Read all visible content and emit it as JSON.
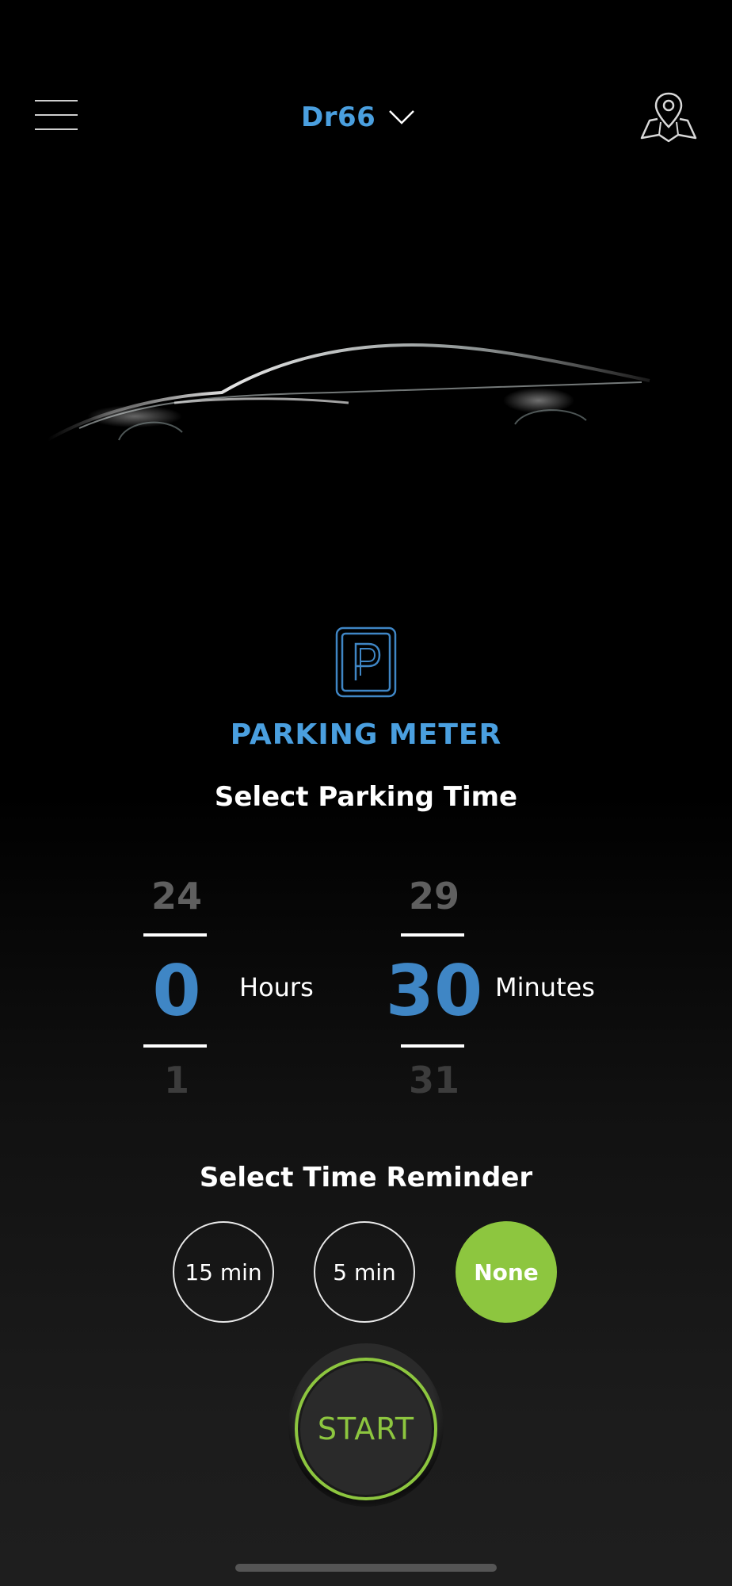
{
  "header": {
    "vehicle_name": "Dr66",
    "menu_icon": "hamburger-menu-icon",
    "vehicle_dropdown_icon": "chevron-down-icon",
    "map_icon": "map-pin-icon"
  },
  "parking": {
    "icon": "parking-sign-icon",
    "title": "PARKING METER",
    "subtitle": "Select Parking Time",
    "hours": {
      "prev": "24",
      "current": "0",
      "next": "1",
      "unit": "Hours"
    },
    "minutes": {
      "prev": "29",
      "current": "30",
      "next": "31",
      "unit": "Minutes"
    }
  },
  "reminder": {
    "title": "Select Time Reminder",
    "options": [
      {
        "label": "15 min",
        "selected": false
      },
      {
        "label": "5 min",
        "selected": false
      },
      {
        "label": "None",
        "selected": true
      }
    ]
  },
  "start_label": "START",
  "colors": {
    "accent_blue": "#4a9fdf",
    "picker_blue": "#3f86c5",
    "accent_green": "#8dc63f",
    "background": "#000000"
  }
}
